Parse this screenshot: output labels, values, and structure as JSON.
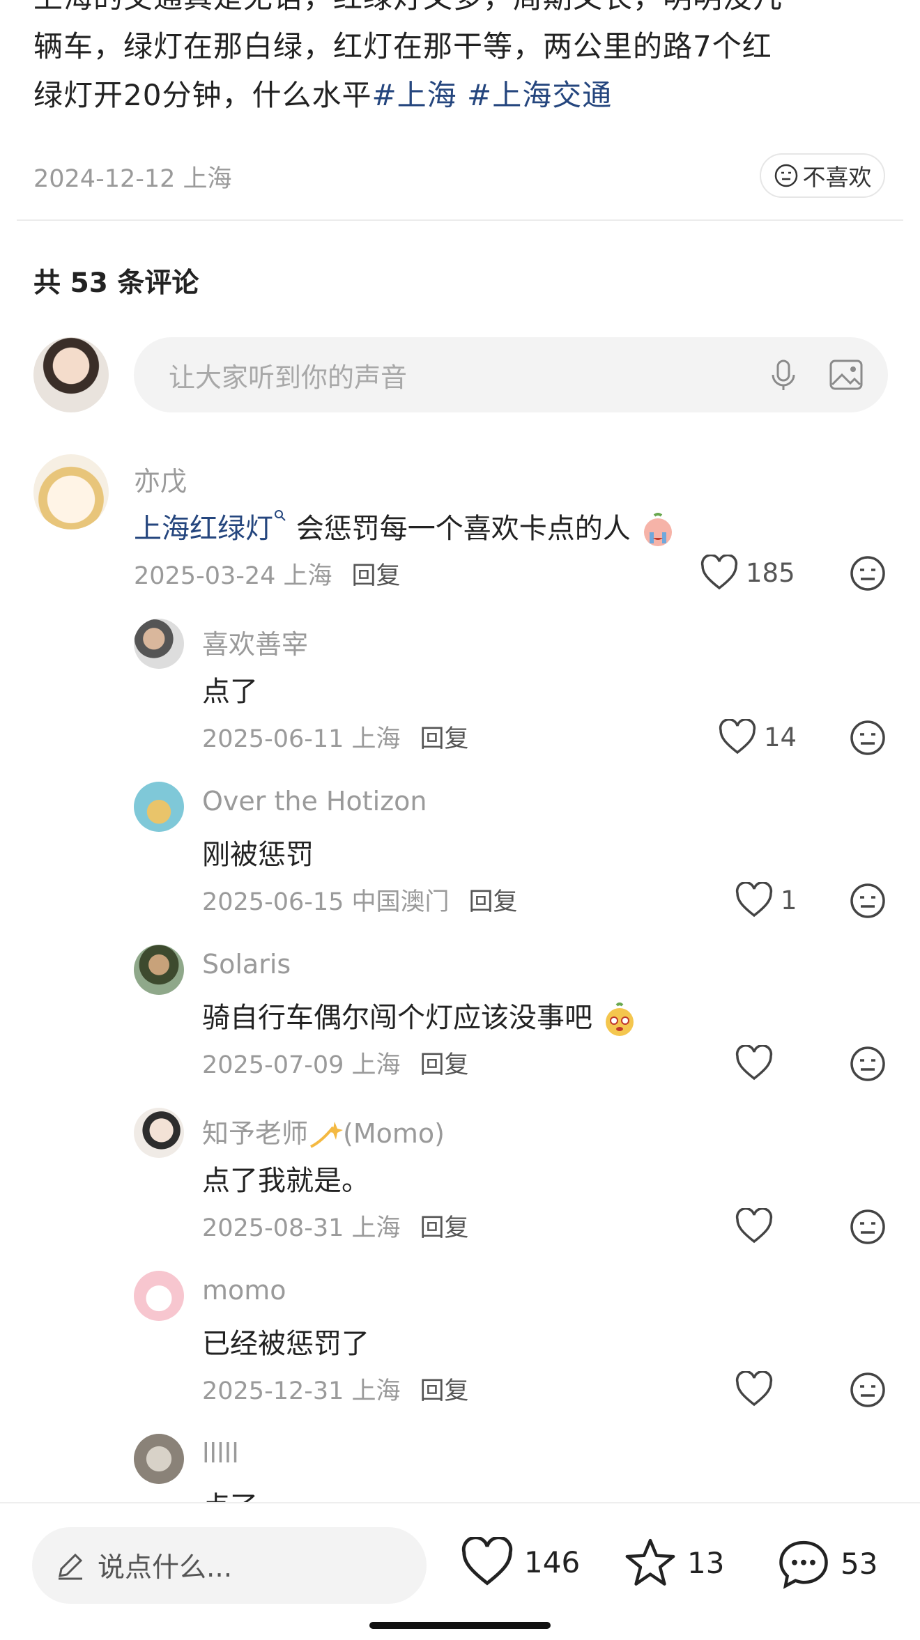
{
  "post": {
    "text_line1": "上海的交通真是无语，红绿灯又多，周期又长，明明没几",
    "text_line2": "辆车，绿灯在那白绿，红灯在那干等，两公里的路7个红",
    "text_line3": "绿灯开20分钟，什么水平",
    "tag1": "#上海",
    "tag2": "#上海交通",
    "meta": "2024-12-12 上海",
    "dislike_label": "不喜欢"
  },
  "comments_header": "共 53 条评论",
  "input": {
    "placeholder": "让大家听到你的声音"
  },
  "comments": [
    {
      "name": "亦戊",
      "link": "上海红绿灯",
      "text": " 会惩罚每一个喜欢卡点的人",
      "date": "2025-03-24 上海",
      "reply": "回复",
      "likes": "185"
    },
    {
      "name": "喜欢善宰",
      "text": "点了",
      "date": "2025-06-11 上海",
      "reply": "回复",
      "likes": "14"
    },
    {
      "name": "Over the Hotizon",
      "text": "刚被惩罚",
      "date": "2025-06-15 中国澳门",
      "reply": "回复",
      "likes": "1"
    },
    {
      "name": "Solaris",
      "text": "骑自行车偶尔闯个灯应该没事吧",
      "date": "2025-07-09 上海",
      "reply": "回复",
      "likes": ""
    },
    {
      "name": "知予老师",
      "name_suffix": "(Momo)",
      "text": "点了我就是。",
      "date": "2025-08-31 上海",
      "reply": "回复",
      "likes": ""
    },
    {
      "name": "momo",
      "text": "已经被惩罚了",
      "date": "2025-12-31 上海",
      "reply": "回复",
      "likes": ""
    },
    {
      "name": "lllll",
      "text": "点了",
      "date": "",
      "reply": "",
      "likes": ""
    }
  ],
  "bottom": {
    "say_placeholder": "说点什么...",
    "likes": "146",
    "stars": "13",
    "comments": "53"
  },
  "colors": {
    "link": "#25467e",
    "muted": "#9a9a9a",
    "text": "#222222"
  }
}
